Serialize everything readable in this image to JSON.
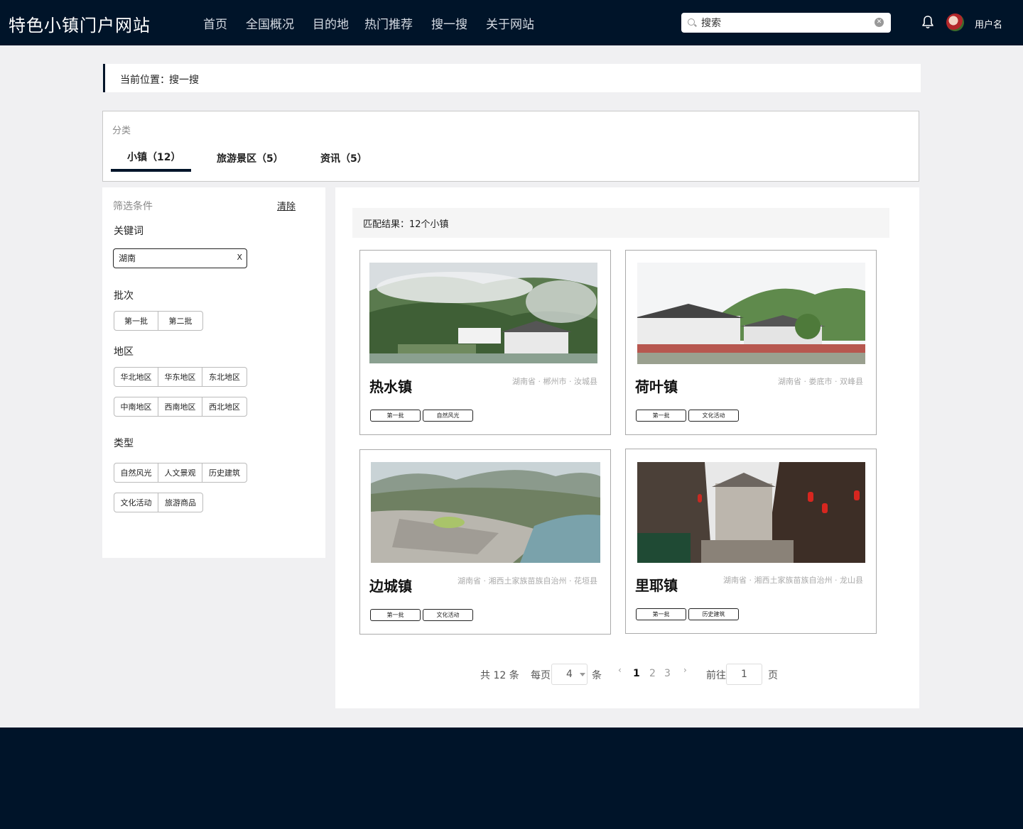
{
  "header": {
    "site_title": "特色小镇门户网站",
    "nav": [
      "首页",
      "全国概况",
      "目的地",
      "热门推荐",
      "搜一搜",
      "关于网站"
    ],
    "search_value": "搜索",
    "user_name": "用户名",
    "bg_color": "#001429"
  },
  "breadcrumb": {
    "prefix": "当前位置：",
    "current": "搜一搜"
  },
  "categories": {
    "label": "分类",
    "tabs": [
      "小镇（12）",
      "旅游景区（5）",
      "资讯（5）"
    ],
    "active_tab": 0
  },
  "filters": {
    "title": "筛选条件",
    "clear_label": "清除",
    "keyword_label": "关键词",
    "keyword_value": "湖南",
    "keyword_clear": "X",
    "batch_label": "批次",
    "batch_options": [
      "第一批",
      "第二批"
    ],
    "region_label": "地区",
    "region_options_row1": [
      "华北地区",
      "华东地区",
      "东北地区"
    ],
    "region_options_row2": [
      "中南地区",
      "西南地区",
      "西北地区"
    ],
    "type_label": "类型",
    "type_options_row1": [
      "自然风光",
      "人文景观",
      "历史建筑"
    ],
    "type_options_row2": [
      "文化活动",
      "旅游商品"
    ]
  },
  "results": {
    "summary": "匹配结果：12个小镇",
    "towns": [
      {
        "name": "热水镇",
        "location": "湖南省 · 郴州市 · 汝城县",
        "tags": [
          "第一批",
          "自然风光"
        ],
        "image": "mountain-village-mist"
      },
      {
        "name": "荷叶镇",
        "location": "湖南省 · 娄底市 · 双峰县",
        "tags": [
          "第一批",
          "文化活动"
        ],
        "image": "old-residence-hills"
      },
      {
        "name": "边城镇",
        "location": "湖南省 · 湘西土家族苗族自治州 · 花垣县",
        "tags": [
          "第一批",
          "文化活动"
        ],
        "image": "river-town-aerial"
      },
      {
        "name": "里耶镇",
        "location": "湖南省 · 湘西土家族苗族自治州 · 龙山县",
        "tags": [
          "第一批",
          "历史建筑"
        ],
        "image": "old-street-lanterns"
      }
    ]
  },
  "pagination": {
    "total_prefix": "共",
    "total": "12",
    "total_suffix": "条",
    "per_page_prefix": "每页",
    "per_page": "4",
    "per_page_suffix": "条",
    "prev_symbol": "‹",
    "next_symbol": "›",
    "pages": [
      "1",
      "2",
      "3"
    ],
    "current_page": "1",
    "goto_prefix": "前往",
    "goto_value": "1",
    "goto_suffix": "页"
  }
}
